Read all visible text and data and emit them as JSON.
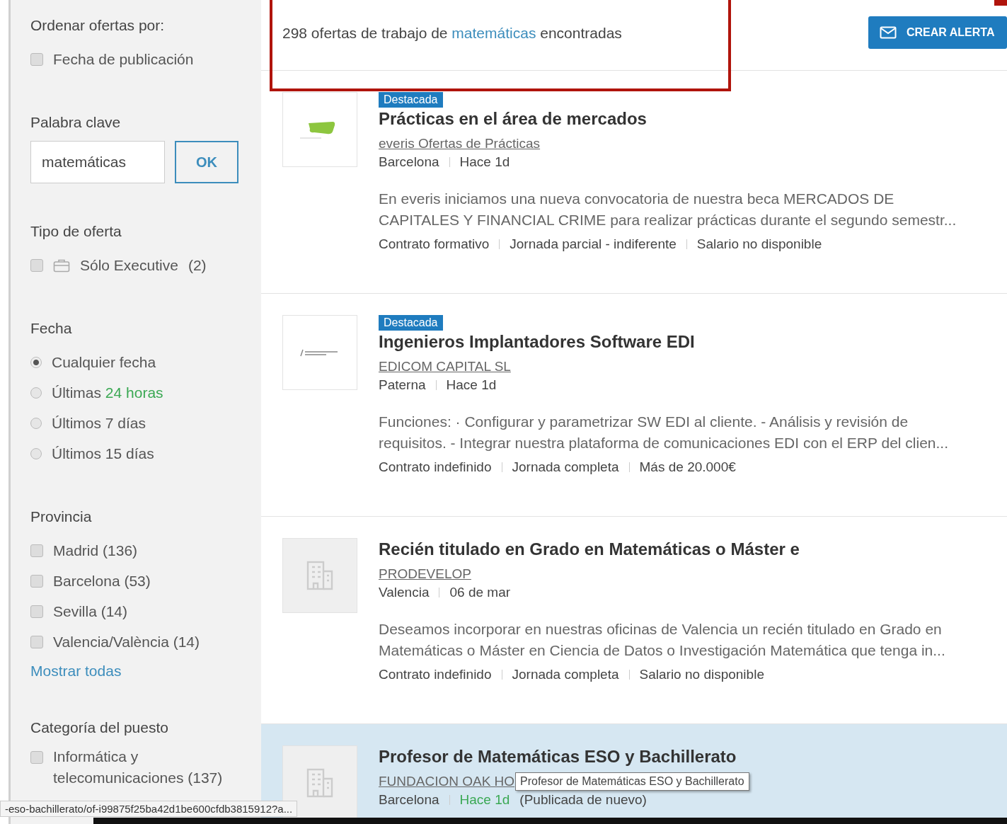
{
  "sidebar": {
    "sort": {
      "heading": "Ordenar ofertas por:",
      "options": [
        {
          "label": "Fecha de publicación",
          "checked": false
        }
      ]
    },
    "keyword": {
      "heading": "Palabra clave",
      "value": "matemáticas",
      "button": "OK"
    },
    "offer_type": {
      "heading": "Tipo de oferta",
      "options": [
        {
          "label": "Sólo Executive",
          "count": "(2)",
          "checked": false
        }
      ]
    },
    "date": {
      "heading": "Fecha",
      "options": [
        {
          "label": "Cualquier fecha",
          "selected": true
        },
        {
          "label": "Últimas",
          "highlight": "24 horas",
          "selected": false
        },
        {
          "label": "Últimos 7 días",
          "selected": false
        },
        {
          "label": "Últimos 15 días",
          "selected": false
        }
      ]
    },
    "province": {
      "heading": "Provincia",
      "options": [
        {
          "label": "Madrid (136)",
          "checked": false
        },
        {
          "label": "Barcelona (53)",
          "checked": false
        },
        {
          "label": "Sevilla (14)",
          "checked": false
        },
        {
          "label": "Valencia/València (14)",
          "checked": false
        }
      ],
      "more_link": "Mostrar todas"
    },
    "category": {
      "heading": "Categoría del puesto",
      "options": [
        {
          "label": "Informática y telecomunicaciones (137)",
          "checked": false
        }
      ]
    }
  },
  "results": {
    "count": "298 ofertas de trabajo de",
    "keyword": "matemáticas",
    "suffix": "encontradas",
    "alert_button": "CREAR ALERTA"
  },
  "jobs": [
    {
      "kind": "green-mark",
      "featured": true,
      "badge": "Destacada",
      "title": "Prácticas en el área de mercados",
      "company": "everis Ofertas de Prácticas",
      "location": "Barcelona",
      "posted": "Hace 1d",
      "posted_recent": false,
      "highlighted": false,
      "description": [
        "En everis iniciamos una nueva convocatoria de nuestra beca MERCADOS DE",
        "CAPITALES Y FINANCIAL CRIME para realizar prácticas durante el segundo semestr..."
      ],
      "tags": [
        "Contrato formativo",
        "Jornada parcial - indiferente",
        "Salario no disponible"
      ]
    },
    {
      "kind": "wordmark",
      "featured": true,
      "badge": "Destacada",
      "title": "Ingenieros Implantadores Software EDI",
      "company": "EDICOM CAPITAL SL",
      "location": "Paterna",
      "posted": "Hace 1d",
      "posted_recent": false,
      "highlighted": false,
      "description": [
        "Funciones: · Configurar y parametrizar SW EDI al cliente. - Análisis y revisión de",
        "requisitos. - Integrar nuestra plataforma de comunicaciones EDI con el ERP del clien..."
      ],
      "tags": [
        "Contrato indefinido",
        "Jornada completa",
        "Más de 20.000€"
      ]
    },
    {
      "kind": "building",
      "featured": false,
      "title": "Recién titulado en Grado en Matemáticas o Máster e",
      "company": "PRODEVELOP",
      "location": "Valencia",
      "posted": "06 de mar",
      "posted_recent": false,
      "highlighted": false,
      "description": [
        "Deseamos incorporar en nuestras oficinas de Valencia un recién titulado en Grado en",
        "Matemáticas o Máster en Ciencia de Datos o Investigación Matemática que tenga in..."
      ],
      "tags": [
        "Contrato indefinido",
        "Jornada completa",
        "Salario no disponible"
      ]
    },
    {
      "kind": "building",
      "featured": false,
      "title": "Profesor de Matemáticas ESO y Bachillerato",
      "company": "FUNDACION OAK HO",
      "location": "Barcelona",
      "posted": "Hace 1d",
      "posted_recent": true,
      "note": "(Publicada de nuevo)",
      "highlighted": true
    }
  ],
  "tooltip": "Profesor de Matemáticas ESO y Bachillerato",
  "status_url": "-eso-bachillerato/of-i99875f25ba42d1be600cfdb3815912?a..."
}
